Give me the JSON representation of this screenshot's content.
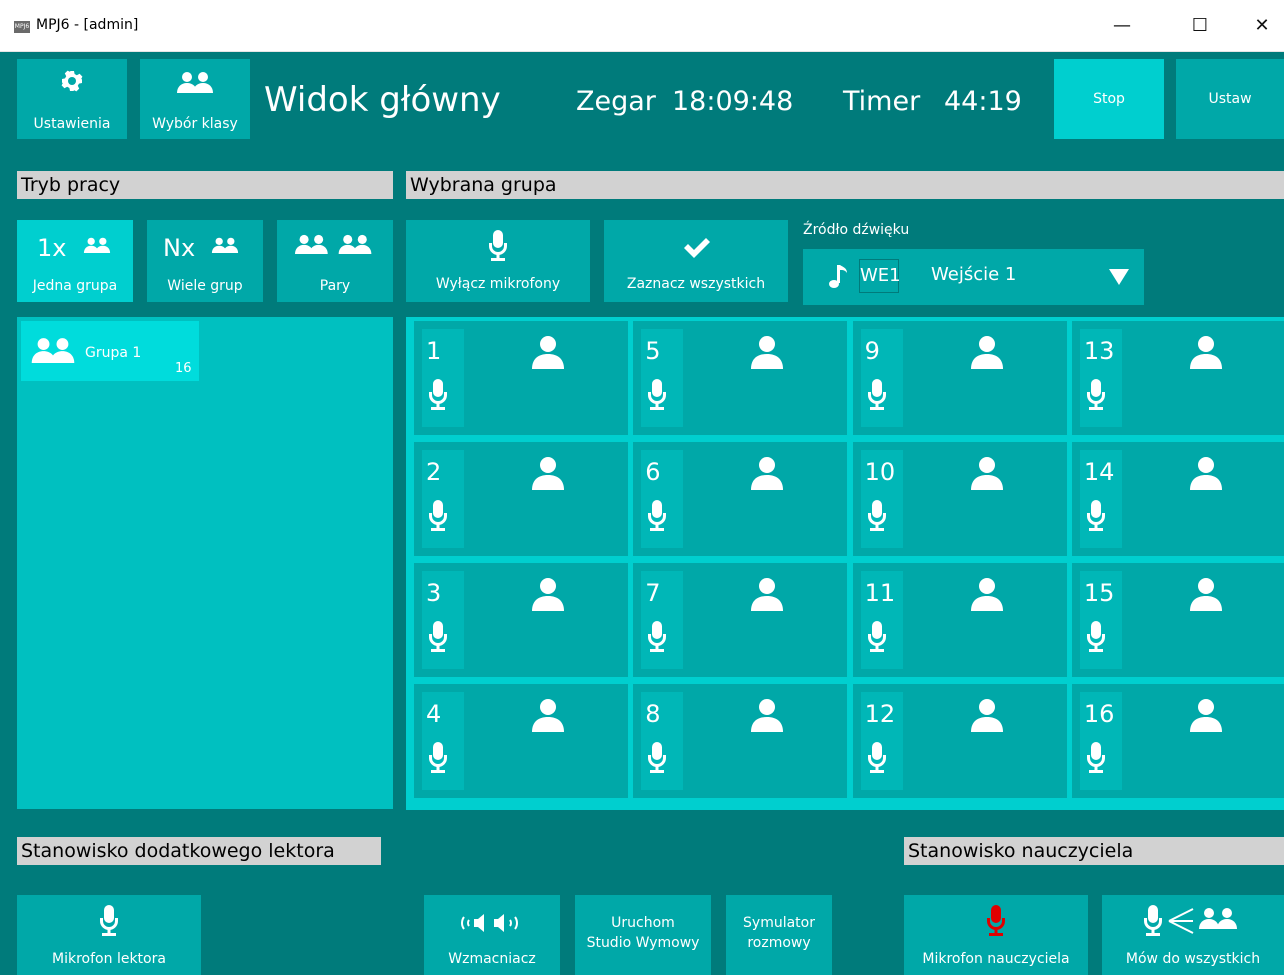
{
  "window": {
    "title": "MPJ6 - [admin]",
    "logo_text": "MPJ6",
    "minimize": "—",
    "maximize": "☐",
    "close": "✕"
  },
  "toolbar": {
    "settings_label": "Ustawienia",
    "class_select_label": "Wybór klasy",
    "view_title": "Widok główny",
    "clock_label": "Zegar",
    "clock_value": "18:09:48",
    "timer_label": "Timer",
    "timer_value": "44:19",
    "stop_label": "Stop",
    "set_label": "Ustaw"
  },
  "work_mode": {
    "header": "Tryb pracy",
    "one_group_prefix": "1x",
    "one_group_label": "Jedna grupa",
    "many_groups_prefix": "Nx",
    "many_groups_label": "Wiele grup",
    "pairs_label": "Pary",
    "selected": "Jedna grupa"
  },
  "groups": [
    {
      "name": "Grupa 1",
      "count": "16"
    }
  ],
  "selected_group": {
    "header": "Wybrana grupa",
    "mics_off_label": "Wyłącz mikrofony",
    "select_all_label": "Zaznacz wszystkich",
    "source_label": "Źródło dźwięku",
    "source_code": "WE1",
    "source_name": "Wejście 1"
  },
  "seats": [
    "1",
    "2",
    "3",
    "4",
    "5",
    "6",
    "7",
    "8",
    "9",
    "10",
    "11",
    "12",
    "13",
    "14",
    "15",
    "16"
  ],
  "extra_lector": {
    "header": "Stanowisko dodatkowego lektora",
    "mic_label": "Mikrofon lektora"
  },
  "bottom_tools": {
    "amplifier_label": "Wzmacniacz",
    "studio_line1": "Uruchom",
    "studio_line2": "Studio Wymowy",
    "sim_line1": "Symulator",
    "sim_line2": "rozmowy"
  },
  "teacher": {
    "header": "Stanowisko nauczyciela",
    "mic_label": "Mikrofon nauczyciela",
    "talk_all_label": "Mów do wszystkich"
  },
  "colors": {
    "background": "#007b7b",
    "tile": "#00a8a8",
    "tile_active": "#00cfcf",
    "header_bar": "#d2d2d2",
    "teacher_mic": "#e00000"
  }
}
